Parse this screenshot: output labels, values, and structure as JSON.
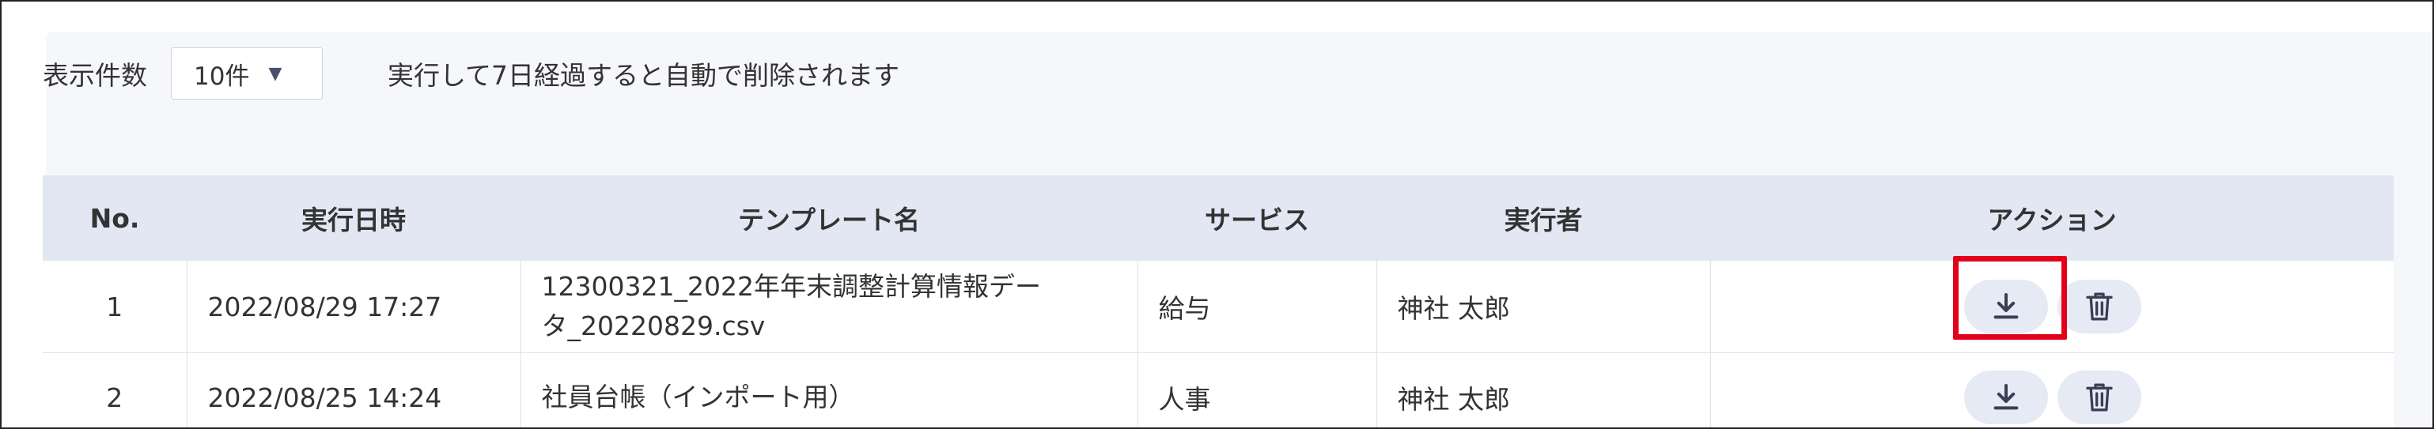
{
  "toolbar": {
    "per_page_label": "表示件数",
    "per_page_value": "10件",
    "notice": "実行して7日経過すると自動で削除されます"
  },
  "table": {
    "headers": [
      "No.",
      "実行日時",
      "テンプレート名",
      "サービス",
      "実行者",
      "アクション"
    ],
    "rows": [
      {
        "no": "1",
        "datetime": "2022/08/29 17:27",
        "template_line1": "12300321_2022年年末調整計算情報デー",
        "template_line2": "タ_20220829.csv",
        "service": "給与",
        "executor": "神社 太郎"
      },
      {
        "no": "2",
        "datetime": "2022/08/25 14:24",
        "template_line1": "社員台帳（インポート用）",
        "template_line2": "",
        "service": "人事",
        "executor": "神社 太郎"
      }
    ]
  },
  "icons": {
    "download": "download-icon",
    "delete": "trash-icon",
    "dropdown": "caret-down-icon"
  },
  "colors": {
    "header_bg": "#e3e7f4",
    "highlight": "#e3001a",
    "icon_button_bg": "#e6eaf5"
  }
}
